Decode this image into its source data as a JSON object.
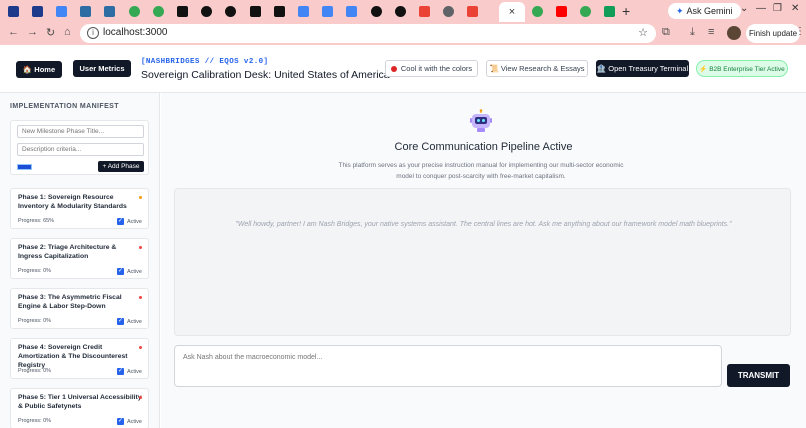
{
  "browser": {
    "tabs": [
      {
        "icon": "email-icon",
        "color": "#1e3a8a"
      },
      {
        "icon": "email-icon",
        "color": "#1e3a8a"
      },
      {
        "icon": "docs-icon",
        "color": "#4285f4"
      },
      {
        "icon": "stack-icon",
        "color": "#2d6da3"
      },
      {
        "icon": "stack-icon",
        "color": "#2d6da3"
      },
      {
        "icon": "google-icon",
        "color": "#34a853"
      },
      {
        "icon": "google-icon",
        "color": "#34a853"
      },
      {
        "icon": "x-icon",
        "color": "#111111"
      },
      {
        "icon": "target-icon",
        "color": "#111111"
      },
      {
        "icon": "target-icon",
        "color": "#111111"
      },
      {
        "icon": "x-icon",
        "color": "#111111"
      },
      {
        "icon": "sync-icon",
        "color": "#111111"
      },
      {
        "icon": "docs-icon",
        "color": "#4285f4"
      },
      {
        "icon": "docs-icon",
        "color": "#4285f4"
      },
      {
        "icon": "docs-icon",
        "color": "#4285f4"
      },
      {
        "icon": "circle-icon",
        "color": "#111111"
      },
      {
        "icon": "github-icon",
        "color": "#111111"
      },
      {
        "icon": "gmail-icon",
        "color": "#ea4335"
      },
      {
        "icon": "globe-icon",
        "color": "#5f6368"
      },
      {
        "icon": "gmail-icon",
        "color": "#ea4335"
      }
    ],
    "tabs_after": [
      {
        "icon": "google-icon",
        "color": "#34a853"
      },
      {
        "icon": "youtube-icon",
        "color": "#ff0000"
      },
      {
        "icon": "google-icon",
        "color": "#34a853"
      },
      {
        "icon": "sheets-icon",
        "color": "#0f9d58"
      }
    ],
    "active_tab_close": "×",
    "new_tab": "+",
    "gemini_label": "Ask Gemini",
    "url": "localhost:3000",
    "finish_update": "Finish update"
  },
  "header": {
    "home_label": "🏠 Home",
    "metrics_label": "User Metrics",
    "brand_sub": "[NASHBRIDGES // EQOS v2.0]",
    "brand_title": "Sovereign Calibration Desk: United States of America",
    "cool_colors_label": "Cool it with the colors",
    "research_label": "📜 View Research & Essays",
    "treasury_label": "🏦 Open Treasury Terminal",
    "tier_badge": "⚡ B2B Enterprise Tier Active"
  },
  "sidebar": {
    "title": "IMPLEMENTATION MANIFEST",
    "milestone_placeholder": "New Milestone Phase Title...",
    "criteria_placeholder": "Description criteria...",
    "add_phase_label": "+ Add Phase",
    "phases": [
      {
        "title": "Phase 1: Sovereign Resource Inventory & Modularity Standards",
        "progress": "Progress: 65%",
        "status": "Active",
        "dot_color": "#f59e0b"
      },
      {
        "title": "Phase 2: Triage Architecture & Ingress Capitalization",
        "progress": "Progress: 0%",
        "status": "Active",
        "dot_color": "#ef4444"
      },
      {
        "title": "Phase 3: The Asymmetric Fiscal Engine & Labor Step-Down",
        "progress": "Progress: 0%",
        "status": "Active",
        "dot_color": "#ef4444"
      },
      {
        "title": "Phase 4: Sovereign Credit Amortization & The Discounterest Registry",
        "progress": "Progress: 0%",
        "status": "Active",
        "dot_color": "#ef4444"
      },
      {
        "title": "Phase 5: Tier 1 Universal Accessibility & Public Safetynets",
        "progress": "Progress: 0%",
        "status": "Active",
        "dot_color": "#ef4444"
      }
    ]
  },
  "main": {
    "title": "Core Communication Pipeline Active",
    "description": "This platform serves as your precise instruction manual for implementing our multi-sector economic model to conquer post-scarcity with free-market capitalism.",
    "welcome_message": "\"Well howdy, partner! I am Nash Bridges, your native systems assistant. The central lines are hot. Ask me anything about our framework model math blueprints.\"",
    "input_placeholder": "Ask Nash about the macroeconomic model...",
    "transmit_label": "TRANSMIT"
  }
}
